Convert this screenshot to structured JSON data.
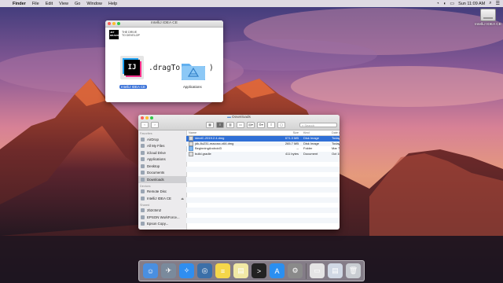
{
  "menubar": {
    "apple": "",
    "items": [
      "Finder",
      "File",
      "Edit",
      "View",
      "Go",
      "Window",
      "Help"
    ],
    "clock": "Sun 11:09 AM"
  },
  "desktop": {
    "disk_label": "IntelliJ IDEA CE"
  },
  "dmg_window": {
    "title": "IntelliJ IDEA CE",
    "logo_text": "JET BRAINS",
    "tagline_1": "THE DRIVE",
    "tagline_2": "TO DEVELOP",
    "app_icon_text": "IJ",
    "app_label": "IntelliJ IDEA CE",
    "drag_text": ".dragTo(",
    "close_paren": ")",
    "apps_label": "Applications"
  },
  "finder": {
    "title": "Downloads",
    "search_placeholder": "Search",
    "sidebar": [
      {
        "type": "head",
        "label": "Favorites"
      },
      {
        "type": "item",
        "label": "AirDrop",
        "icon": "airdrop-icon"
      },
      {
        "type": "item",
        "label": "All My Files",
        "icon": "all-files-icon"
      },
      {
        "type": "item",
        "label": "iCloud Drive",
        "icon": "cloud-icon"
      },
      {
        "type": "item",
        "label": "Applications",
        "icon": "applications-icon"
      },
      {
        "type": "item",
        "label": "Desktop",
        "icon": "desktop-icon"
      },
      {
        "type": "item",
        "label": "Documents",
        "icon": "documents-icon"
      },
      {
        "type": "item",
        "label": "Downloads",
        "icon": "downloads-icon",
        "active": true
      },
      {
        "type": "head",
        "label": "Devices"
      },
      {
        "type": "item",
        "label": "Remote Disc",
        "icon": "disc-icon"
      },
      {
        "type": "item",
        "label": "IntelliJ IDEA CE",
        "icon": "disk-icon",
        "eject": true
      },
      {
        "type": "head",
        "label": "Shared"
      },
      {
        "type": "item",
        "label": "2b2c5m2",
        "icon": "computer-icon"
      },
      {
        "type": "item",
        "label": "EPSON WorkForce...",
        "icon": "computer-icon"
      },
      {
        "type": "item",
        "label": "Epson Copy...",
        "icon": "computer-icon"
      }
    ],
    "columns": {
      "name": "Name",
      "size": "Size",
      "kind": "Kind",
      "date": "Date Added"
    },
    "files": [
      {
        "name": "ideaIC-2019.2.4.dmg",
        "size": "671.3 MB",
        "kind": "Disk Image",
        "date": "Today, 11:0",
        "folder": false,
        "selected": true
      },
      {
        "name": "jdk-8u231-macosx-x64.dmg",
        "size": "265.7 MB",
        "kind": "Disk Image",
        "date": "Today, 10:",
        "folder": false,
        "selected": false
      },
      {
        "name": "BeginningAndroid3",
        "size": "--",
        "kind": "Folder",
        "date": "Mar 7, 2019",
        "folder": true,
        "selected": false
      },
      {
        "name": "build.gradle",
        "size": "411 bytes",
        "kind": "Document",
        "date": "Oct 16, 2018",
        "folder": false,
        "selected": false
      }
    ]
  },
  "dock": {
    "icons": [
      {
        "name": "finder-icon",
        "color": "#4a8fe0",
        "glyph": "☺"
      },
      {
        "name": "launchpad-icon",
        "color": "#7a8a9c",
        "glyph": "✈"
      },
      {
        "name": "safari-icon",
        "color": "#2f8ef0",
        "glyph": "✧"
      },
      {
        "name": "quicktime-icon",
        "color": "#3b6fa8",
        "glyph": "◎"
      },
      {
        "name": "notes-icon",
        "color": "#f5d74a",
        "glyph": "≡"
      },
      {
        "name": "stickies-icon",
        "color": "#f1e9a5",
        "glyph": "▤"
      },
      {
        "name": "terminal-icon",
        "color": "#222222",
        "glyph": ">"
      },
      {
        "name": "app-store-icon",
        "color": "#2a8ff0",
        "glyph": "A"
      },
      {
        "name": "system-preferences-icon",
        "color": "#8a8a8a",
        "glyph": "⚙"
      },
      {
        "name": "separator",
        "color": "",
        "glyph": ""
      },
      {
        "name": "disk-image-dock-icon",
        "color": "#e4e4e4",
        "glyph": "▭"
      },
      {
        "name": "downloads-stack-icon",
        "color": "#d0d8e4",
        "glyph": "▤"
      },
      {
        "name": "trash-icon",
        "color": "#c9cdd2",
        "glyph": "🗑"
      }
    ]
  }
}
